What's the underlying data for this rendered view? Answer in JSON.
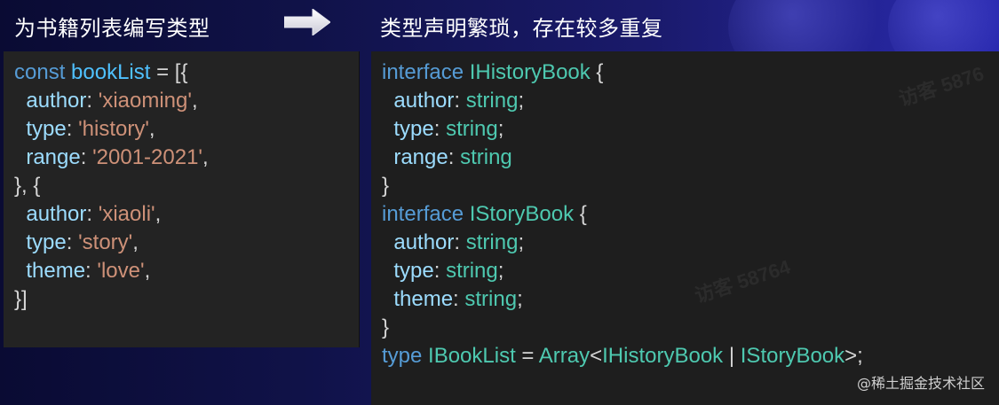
{
  "header": {
    "left_title": "为书籍列表编写类型",
    "right_title": "类型声明繁琐，存在较多重复"
  },
  "left_code": [
    [
      {
        "t": "kw",
        "v": "const "
      },
      {
        "t": "var",
        "v": "bookList"
      },
      {
        "t": "punct",
        "v": " = [{"
      }
    ],
    [
      {
        "t": "punct",
        "v": "  "
      },
      {
        "t": "prop",
        "v": "author"
      },
      {
        "t": "punct",
        "v": ": "
      },
      {
        "t": "str",
        "v": "'xiaoming'"
      },
      {
        "t": "punct",
        "v": ","
      }
    ],
    [
      {
        "t": "punct",
        "v": "  "
      },
      {
        "t": "prop",
        "v": "type"
      },
      {
        "t": "punct",
        "v": ": "
      },
      {
        "t": "str",
        "v": "'history'"
      },
      {
        "t": "punct",
        "v": ","
      }
    ],
    [
      {
        "t": "punct",
        "v": "  "
      },
      {
        "t": "prop",
        "v": "range"
      },
      {
        "t": "punct",
        "v": ": "
      },
      {
        "t": "str",
        "v": "'2001-2021'"
      },
      {
        "t": "punct",
        "v": ","
      }
    ],
    [
      {
        "t": "punct",
        "v": "}, {"
      }
    ],
    [
      {
        "t": "punct",
        "v": "  "
      },
      {
        "t": "prop",
        "v": "author"
      },
      {
        "t": "punct",
        "v": ": "
      },
      {
        "t": "str",
        "v": "'xiaoli'"
      },
      {
        "t": "punct",
        "v": ","
      }
    ],
    [
      {
        "t": "punct",
        "v": "  "
      },
      {
        "t": "prop",
        "v": "type"
      },
      {
        "t": "punct",
        "v": ": "
      },
      {
        "t": "str",
        "v": "'story'"
      },
      {
        "t": "punct",
        "v": ","
      }
    ],
    [
      {
        "t": "punct",
        "v": "  "
      },
      {
        "t": "prop",
        "v": "theme"
      },
      {
        "t": "punct",
        "v": ": "
      },
      {
        "t": "str",
        "v": "'love'"
      },
      {
        "t": "punct",
        "v": ","
      }
    ],
    [
      {
        "t": "punct",
        "v": "}]"
      }
    ]
  ],
  "right_code": [
    [
      {
        "t": "kw",
        "v": "interface "
      },
      {
        "t": "type",
        "v": "IHistoryBook"
      },
      {
        "t": "punct",
        "v": " {"
      }
    ],
    [
      {
        "t": "punct",
        "v": "  "
      },
      {
        "t": "prop",
        "v": "author"
      },
      {
        "t": "punct",
        "v": ": "
      },
      {
        "t": "type",
        "v": "string"
      },
      {
        "t": "punct",
        "v": ";"
      }
    ],
    [
      {
        "t": "punct",
        "v": "  "
      },
      {
        "t": "prop",
        "v": "type"
      },
      {
        "t": "punct",
        "v": ": "
      },
      {
        "t": "type",
        "v": "string"
      },
      {
        "t": "punct",
        "v": ";"
      }
    ],
    [
      {
        "t": "punct",
        "v": "  "
      },
      {
        "t": "prop",
        "v": "range"
      },
      {
        "t": "punct",
        "v": ": "
      },
      {
        "t": "type",
        "v": "string"
      }
    ],
    [
      {
        "t": "punct",
        "v": "}"
      }
    ],
    [
      {
        "t": "kw",
        "v": "interface "
      },
      {
        "t": "type",
        "v": "IStoryBook"
      },
      {
        "t": "punct",
        "v": " {"
      }
    ],
    [
      {
        "t": "punct",
        "v": "  "
      },
      {
        "t": "prop",
        "v": "author"
      },
      {
        "t": "punct",
        "v": ": "
      },
      {
        "t": "type",
        "v": "string"
      },
      {
        "t": "punct",
        "v": ";"
      }
    ],
    [
      {
        "t": "punct",
        "v": "  "
      },
      {
        "t": "prop",
        "v": "type"
      },
      {
        "t": "punct",
        "v": ": "
      },
      {
        "t": "type",
        "v": "string"
      },
      {
        "t": "punct",
        "v": ";"
      }
    ],
    [
      {
        "t": "punct",
        "v": "  "
      },
      {
        "t": "prop",
        "v": "theme"
      },
      {
        "t": "punct",
        "v": ": "
      },
      {
        "t": "type",
        "v": "string"
      },
      {
        "t": "punct",
        "v": ";"
      }
    ],
    [
      {
        "t": "punct",
        "v": "}"
      }
    ],
    [
      {
        "t": "kw",
        "v": "type "
      },
      {
        "t": "type",
        "v": "IBookList"
      },
      {
        "t": "punct",
        "v": " = "
      },
      {
        "t": "type",
        "v": "Array"
      },
      {
        "t": "punct",
        "v": "<"
      },
      {
        "t": "type",
        "v": "IHistoryBook"
      },
      {
        "t": "punct",
        "v": " | "
      },
      {
        "t": "type",
        "v": "IStoryBook"
      },
      {
        "t": "punct",
        "v": ">;"
      }
    ]
  ],
  "watermark": "@稀土掘金技术社区",
  "arrow_icon": "right-arrow-icon",
  "colors": {
    "keyword": "#569cd6",
    "variable": "#4fc1ff",
    "property": "#9cdcfe",
    "string": "#ce9178",
    "type": "#4ec9b0",
    "punctuation": "#d4d4d4"
  }
}
